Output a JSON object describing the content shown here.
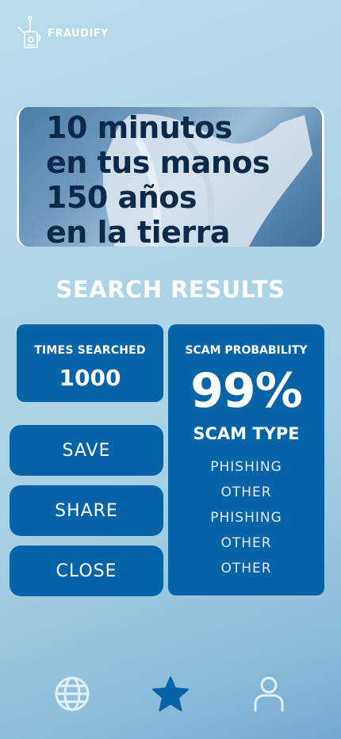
{
  "app": {
    "name": "FRAUDIFY",
    "logo_icon": "hook-logo-icon"
  },
  "banner": {
    "lines": [
      "10 minutos",
      "en tus manos",
      "150 años",
      "en la tierra"
    ]
  },
  "results": {
    "title": "SEARCH RESULTS",
    "times_searched_label": "TIMES SEARCHED",
    "times_searched_value": "1000",
    "scam_probability_label": "SCAM PROBABILITY",
    "scam_probability_value": "99%",
    "scam_type_label": "SCAM TYPE",
    "scam_types": [
      "PHISHING",
      "OTHER",
      "PHISHING",
      "OTHER",
      "OTHER"
    ]
  },
  "actions": {
    "save_label": "SAVE",
    "share_label": "SHARE",
    "close_label": "CLOSE"
  },
  "nav": {
    "items": [
      {
        "icon": "globe-icon",
        "active": false
      },
      {
        "icon": "star-icon",
        "active": true
      },
      {
        "icon": "user-icon",
        "active": false
      }
    ]
  },
  "colors": {
    "primary": "#0563a8",
    "nav_inactive": "#e3f0f7",
    "banner_text": "#0b2a4a"
  }
}
